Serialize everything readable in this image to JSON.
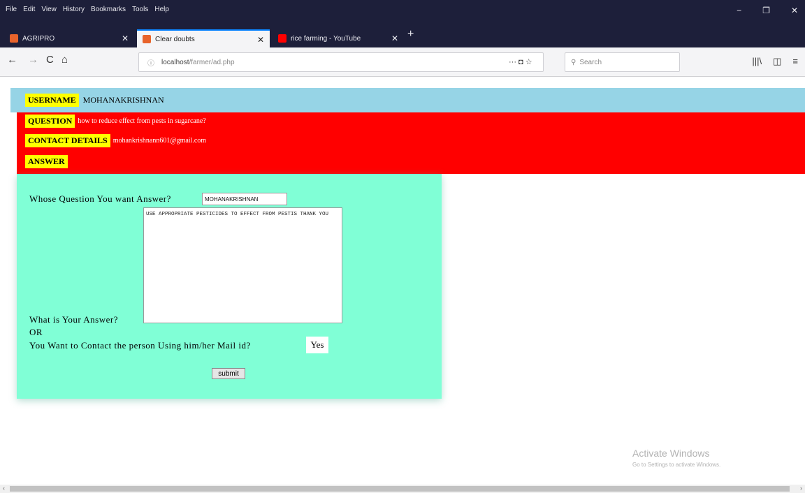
{
  "menubar": {
    "items": [
      "File",
      "Edit",
      "View",
      "History",
      "Bookmarks",
      "Tools",
      "Help"
    ],
    "minimize": "−",
    "maximize": "❐",
    "close": "✕"
  },
  "tabs": [
    {
      "title": "AGRIPRO",
      "close": "✕",
      "icon_color": "#e8632b"
    },
    {
      "title": "Clear doubts",
      "close": "✕",
      "icon_color": "#e8632b"
    },
    {
      "title": "rice farming - YouTube",
      "close": "✕",
      "icon_color": "#ff0000"
    }
  ],
  "new_tab": "+",
  "nav": {
    "back": "←",
    "forward": "→",
    "reload": "C",
    "home": "⌂",
    "url_host": "localhost",
    "url_path": "/farmer/ad.php",
    "page_actions": "···  ◘  ☆",
    "search_placeholder": "Search",
    "tools": [
      "|||\\",
      "◫",
      "≡"
    ]
  },
  "page": {
    "username_label": "USERNAME",
    "username_value": "MOHANAKRISHNAN",
    "question_label": "QUESTION",
    "question_value": "how to reduce effect from pests in sugarcane?",
    "contact_label": "CONTACT DETAILS",
    "contact_value": "mohankrishnann601@gmail.com",
    "answer_label": "ANSWER",
    "whose_label": "Whose Question You want Answer?",
    "whose_value": "MOHANAKRISHNAN",
    "answer_text": "USE APPROPRIATE PESTICIDES TO EFFECT FROM PESTIS THANK YOU",
    "your_answer_label": "What is Your Answer?",
    "or_label": "OR",
    "contact_prompt": "You Want to Contact the person Using him/her Mail id?",
    "yes_label": "Yes",
    "submit_label": "submit"
  },
  "watermark": {
    "line1": "Activate Windows",
    "line2": "Go to Settings to activate Windows."
  },
  "scroll": {
    "left": "‹",
    "right": "›"
  },
  "colors": {
    "username_bar": "#96d4e6",
    "red_panel": "#ff0000",
    "label_bg": "#ffff00",
    "answer_panel": "#80ffd6"
  }
}
